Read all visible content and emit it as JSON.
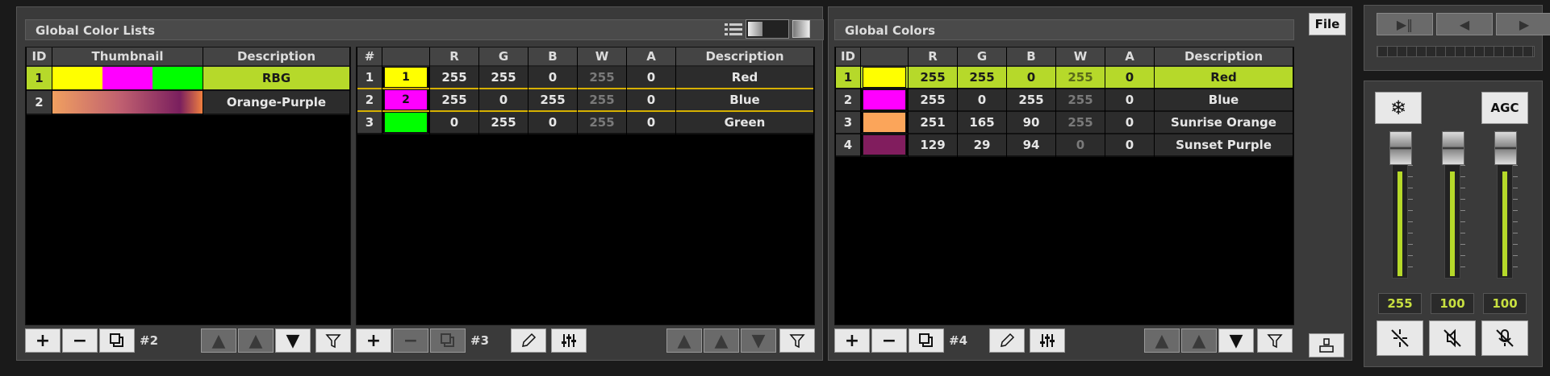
{
  "color_lists": {
    "title": "Global Color Lists",
    "columns": [
      "ID",
      "Thumbnail",
      "Description"
    ],
    "rows": [
      {
        "id": "1",
        "description": "RBG",
        "selected": true
      },
      {
        "id": "2",
        "description": "Orange-Purple",
        "selected": false
      }
    ],
    "count": "#2"
  },
  "list_colors": {
    "columns": [
      "#",
      "",
      "R",
      "G",
      "B",
      "W",
      "A",
      "Description"
    ],
    "rows": [
      {
        "idx": "1",
        "swatch_label": "1",
        "swatch_color": "#ffff00",
        "r": "255",
        "g": "255",
        "b": "0",
        "w": "255",
        "a": "0",
        "description": "Red"
      },
      {
        "idx": "2",
        "swatch_label": "2",
        "swatch_color": "#ff00ff",
        "r": "255",
        "g": "0",
        "b": "255",
        "w": "255",
        "a": "0",
        "description": "Blue"
      },
      {
        "idx": "3",
        "swatch_label": "",
        "swatch_color": "#00ff00",
        "r": "0",
        "g": "255",
        "b": "0",
        "w": "255",
        "a": "0",
        "description": "Green"
      }
    ],
    "count": "#3"
  },
  "global_colors": {
    "title": "Global Colors",
    "columns": [
      "ID",
      "",
      "R",
      "G",
      "B",
      "W",
      "A",
      "Description"
    ],
    "rows": [
      {
        "id": "1",
        "swatch_color": "#ffff00",
        "r": "255",
        "g": "255",
        "b": "0",
        "w": "255",
        "a": "0",
        "description": "Red",
        "selected": true
      },
      {
        "id": "2",
        "swatch_color": "#ff00ff",
        "r": "255",
        "g": "0",
        "b": "255",
        "w": "255",
        "a": "0",
        "description": "Blue",
        "selected": false
      },
      {
        "id": "3",
        "swatch_color": "#fba55a",
        "r": "251",
        "g": "165",
        "b": "90",
        "w": "255",
        "a": "0",
        "description": "Sunrise Orange",
        "selected": false
      },
      {
        "id": "4",
        "swatch_color": "#811d5e",
        "r": "129",
        "g": "29",
        "b": "94",
        "w": "0",
        "a": "0",
        "description": "Sunset Purple",
        "selected": false
      }
    ],
    "count": "#4"
  },
  "file_label": "File",
  "agc_label": "AGC",
  "faders": [
    {
      "value": "255",
      "level": 1.0
    },
    {
      "value": "100",
      "level": 1.0
    },
    {
      "value": "100",
      "level": 1.0
    }
  ],
  "accent_color": "#b6d92a"
}
